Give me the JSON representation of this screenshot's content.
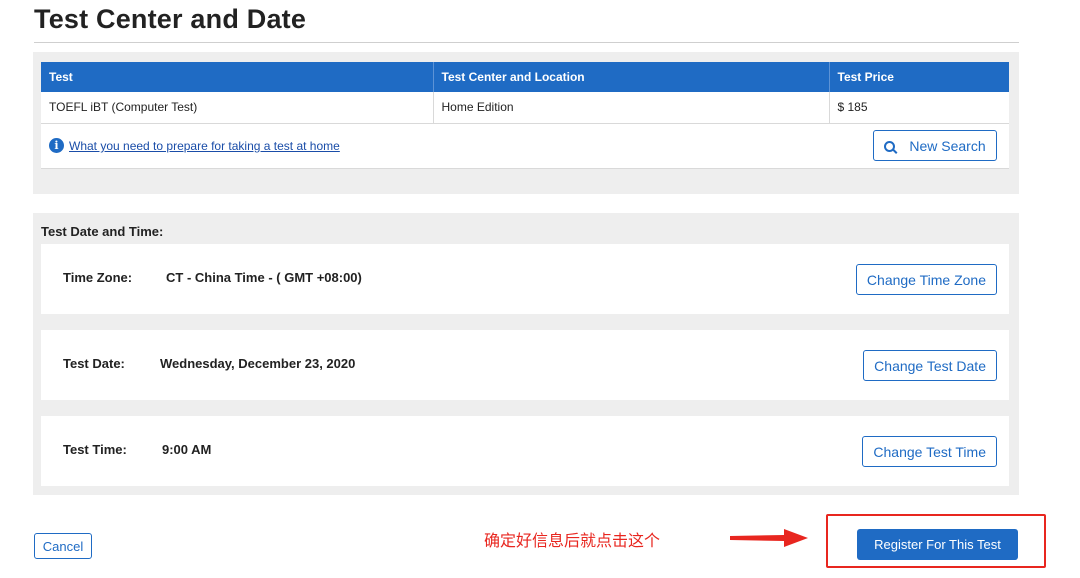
{
  "page_title": "Test Center and Date",
  "test_table": {
    "headers": [
      "Test",
      "Test Center and Location",
      "Test Price"
    ],
    "row": [
      "TOEFL iBT (Computer Test)",
      "Home Edition",
      "$ 185"
    ]
  },
  "prep_link": "What you need to prepare for taking a test at home",
  "new_search_label": "New Search",
  "date_time": {
    "heading": "Test Date and Time:",
    "time_zone": {
      "label": "Time Zone:",
      "value": "CT - China Time - ( GMT +08:00)",
      "button": "Change Time Zone"
    },
    "test_date": {
      "label": "Test Date:",
      "value": "Wednesday, December 23, 2020",
      "button": "Change Test Date"
    },
    "test_time": {
      "label": "Test Time:",
      "value": "9:00 AM",
      "button": "Change Test Time"
    }
  },
  "footer": {
    "cancel_label": "Cancel",
    "annotation": "确定好信息后就点击这个",
    "register_label": "Register For This Test"
  },
  "colors": {
    "primary": "#1f6bc4",
    "annotation_red": "#e8261f",
    "panel_bg": "#eeeeee"
  },
  "icons": [
    "info-icon",
    "search-icon",
    "arrow-right-icon"
  ]
}
